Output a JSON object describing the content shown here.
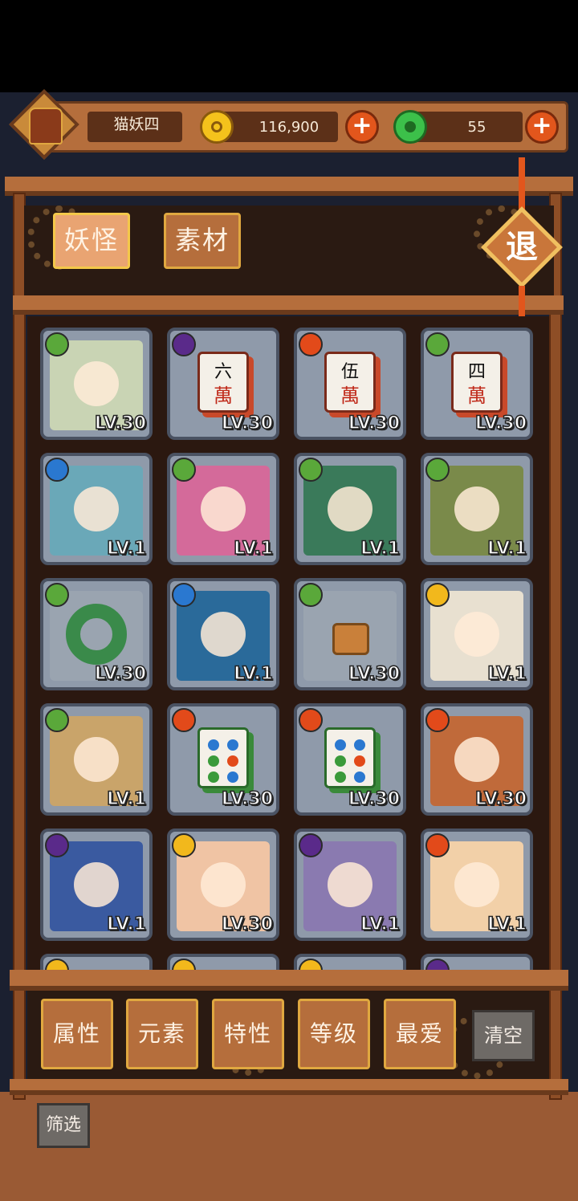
{
  "player": {
    "nickname": "猫妖四"
  },
  "currency": [
    {
      "name": "gold",
      "amount": "116,900"
    },
    {
      "name": "jade",
      "amount": "55"
    }
  ],
  "tabs": [
    {
      "label": "妖怪",
      "active": true
    },
    {
      "label": "素材",
      "active": false
    }
  ],
  "exit_label": "退",
  "cards": [
    {
      "element": "wood",
      "level": "LV.30",
      "art": "twins"
    },
    {
      "element": "dark",
      "level": "LV.30",
      "art": "tile",
      "tile_char": "六"
    },
    {
      "element": "fire",
      "level": "LV.30",
      "art": "tile",
      "tile_char": "伍"
    },
    {
      "element": "wood",
      "level": "LV.30",
      "art": "tile",
      "tile_char": "四"
    },
    {
      "element": "water",
      "level": "LV.1",
      "art": "archer"
    },
    {
      "element": "wood",
      "level": "LV.1",
      "art": "flower"
    },
    {
      "element": "wood",
      "level": "LV.1",
      "art": "witch"
    },
    {
      "element": "wood",
      "level": "LV.1",
      "art": "general"
    },
    {
      "element": "wood",
      "level": "LV.30",
      "art": "ring"
    },
    {
      "element": "water",
      "level": "LV.1",
      "art": "mage"
    },
    {
      "element": "wood",
      "level": "LV.30",
      "art": "stump"
    },
    {
      "element": "light",
      "level": "LV.1",
      "art": "beast"
    },
    {
      "element": "wood",
      "level": "LV.1",
      "art": "cart"
    },
    {
      "element": "fire",
      "level": "LV.30",
      "art": "dots"
    },
    {
      "element": "fire",
      "level": "LV.30",
      "art": "dots"
    },
    {
      "element": "fire",
      "level": "LV.30",
      "art": "horse"
    },
    {
      "element": "dark",
      "level": "LV.1",
      "art": "blue-monster"
    },
    {
      "element": "light",
      "level": "LV.30",
      "art": "pig"
    },
    {
      "element": "dark",
      "level": "LV.1",
      "art": "horned"
    },
    {
      "element": "fire",
      "level": "LV.1",
      "art": "round"
    }
  ],
  "partial_row_elements": [
    "light",
    "light",
    "light",
    "dark"
  ],
  "filters": [
    "属性",
    "元素",
    "特性",
    "等级",
    "最爱"
  ],
  "clear_label": "清空",
  "screen_label": "筛选",
  "colors": {
    "wood": "#5aa83a",
    "dark": "#5a2a8a",
    "fire": "#e24a1a",
    "water": "#2a78d0",
    "light": "#f2b81c"
  }
}
